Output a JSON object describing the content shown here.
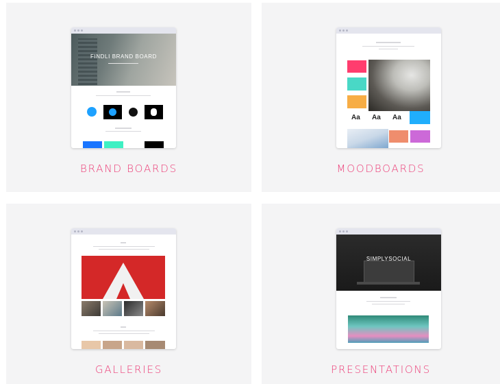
{
  "cards": [
    {
      "label": "BRAND BOARDS",
      "preview_title": "FINDLI BRAND BOARD"
    },
    {
      "label": "MOODBOARDS"
    },
    {
      "label": "GALLERIES"
    },
    {
      "label": "PRESENTATIONS",
      "preview_title": "SIMPLYSOCIAL"
    }
  ],
  "moodboard": {
    "type_samples": [
      "Aa",
      "Aa",
      "Aa"
    ]
  },
  "colors": {
    "accent": "#ec3b76",
    "swatches": [
      "#ff3d6e",
      "#49d8c6",
      "#f7ad45",
      "#20aefc",
      "#ef8d6d",
      "#cc69d8"
    ],
    "brand_palette": [
      "#1975ff",
      "#3ef0c3",
      "#000000"
    ]
  }
}
